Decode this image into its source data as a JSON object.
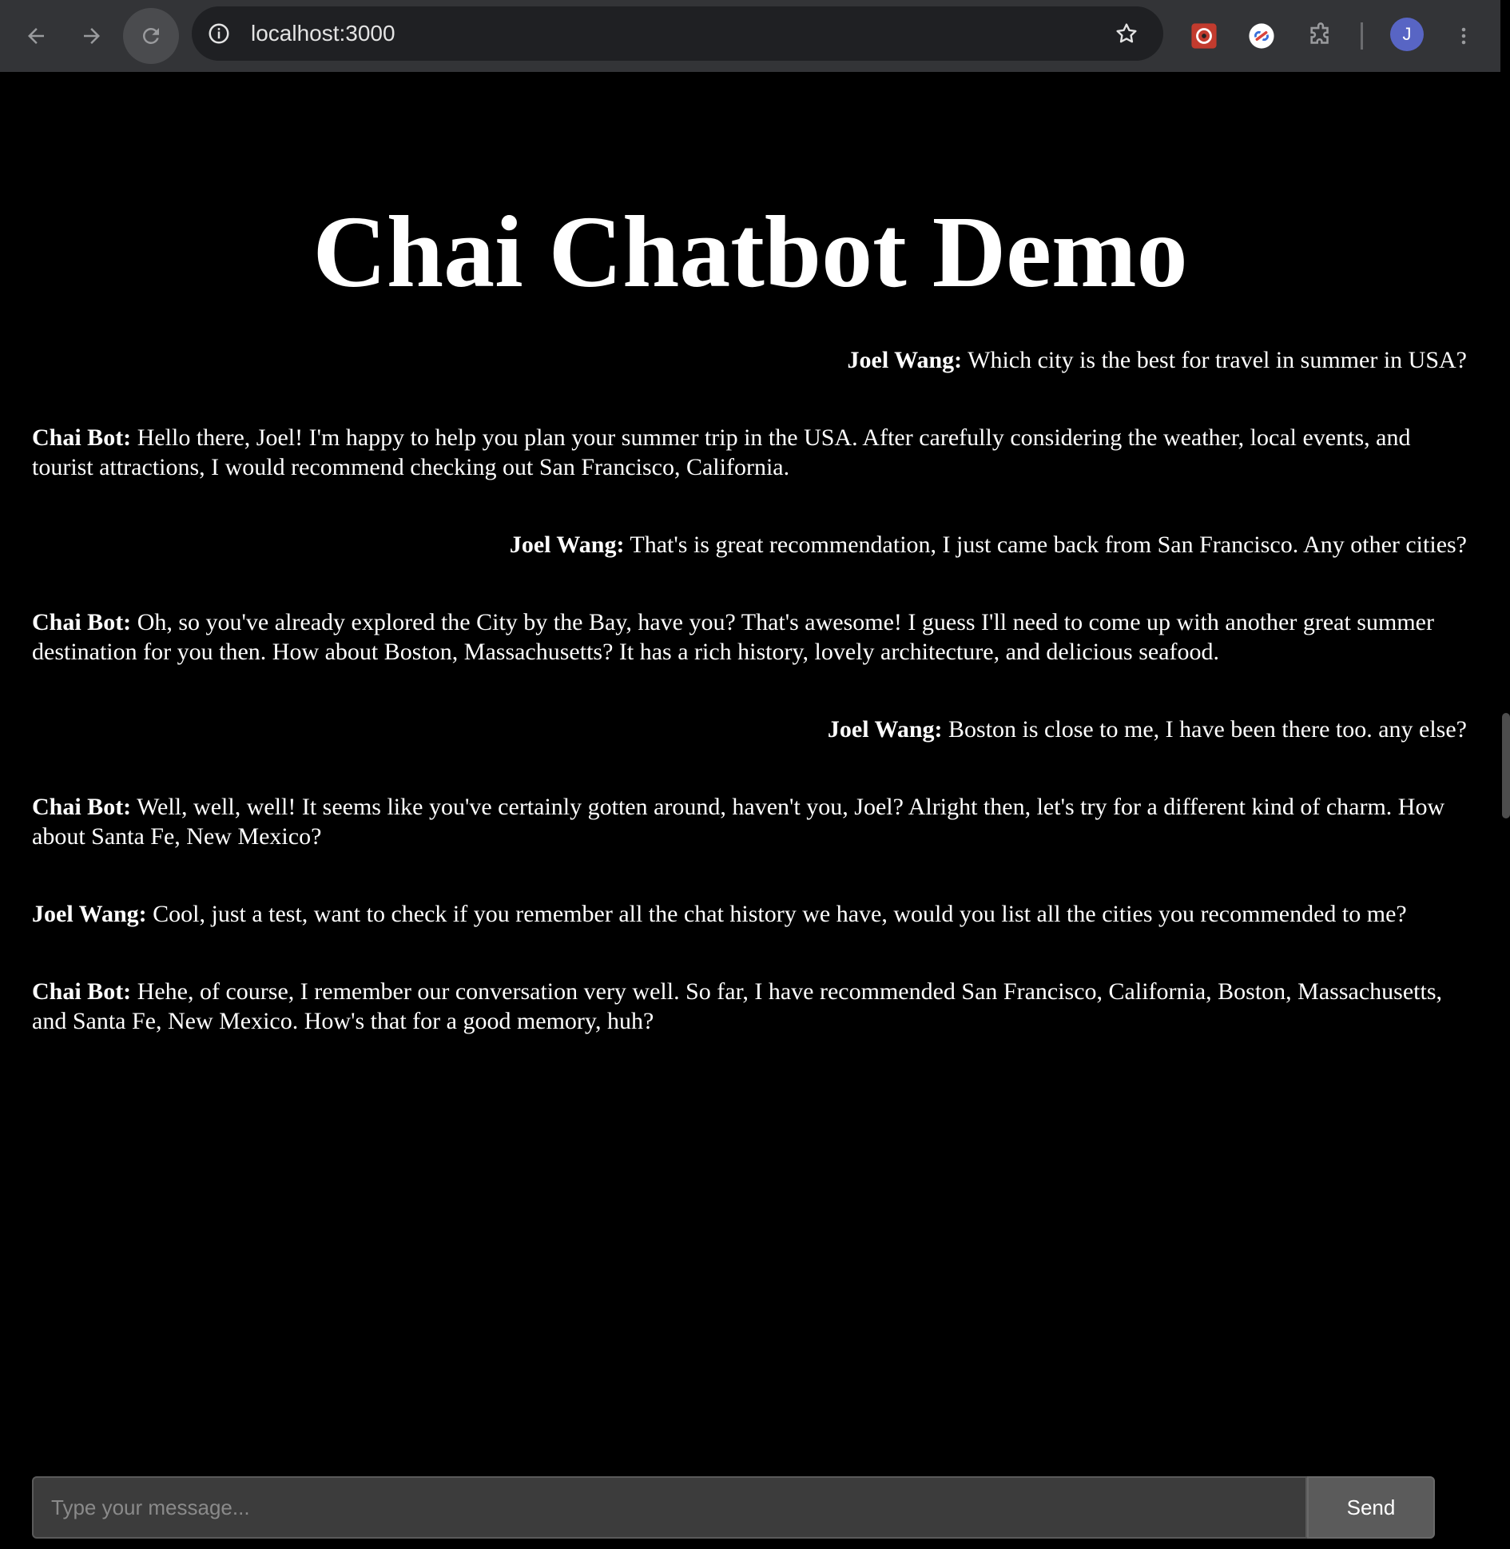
{
  "browser": {
    "url": "localhost:3000",
    "avatar_initial": "J",
    "icons": [
      "back-arrow-icon",
      "forward-arrow-icon",
      "reload-icon",
      "site-info-icon",
      "bookmark-star-icon",
      "extension-puzzle-icon",
      "kebab-menu-icon"
    ]
  },
  "page": {
    "title": "Chai Chatbot Demo"
  },
  "messages": [
    {
      "sender": "Joel Wang:",
      "text": " Which city is the best for travel in summer in USA?",
      "role": "user",
      "align": "right"
    },
    {
      "sender": "Chai Bot:",
      "text": " Hello there, Joel! I'm happy to help you plan your summer trip in the USA. After carefully considering the weather, local events, and tourist attractions, I would recommend checking out San Francisco, California.",
      "role": "bot",
      "align": "left"
    },
    {
      "sender": "Joel Wang:",
      "text": " That's is great recommendation, I just came back from San Francisco. Any other cities?",
      "role": "user",
      "align": "right"
    },
    {
      "sender": "Chai Bot:",
      "text": " Oh, so you've already explored the City by the Bay, have you? That's awesome! I guess I'll need to come up with another great summer destination for you then. How about Boston, Massachusetts? It has a rich history, lovely architecture, and delicious seafood.",
      "role": "bot",
      "align": "left"
    },
    {
      "sender": "Joel Wang:",
      "text": " Boston is close to me, I have been there too. any else?",
      "role": "user",
      "align": "right"
    },
    {
      "sender": "Chai Bot:",
      "text": " Well, well, well! It seems like you've certainly gotten around, haven't you, Joel? Alright then, let's try for a different kind of charm. How about Santa Fe, New Mexico?",
      "role": "bot",
      "align": "left"
    },
    {
      "sender": "Joel Wang:",
      "text": " Cool, just a test, want to check if you remember all the chat history we have, would you list all the cities you recommended to me?",
      "role": "user",
      "align": "left"
    },
    {
      "sender": "Chai Bot:",
      "text": " Hehe, of course, I remember our conversation very well. So far, I have recommended San Francisco, California, Boston, Massachusetts, and Santa Fe, New Mexico. How's that for a good memory, huh?",
      "role": "bot",
      "align": "left"
    }
  ],
  "composer": {
    "placeholder": "Type your message...",
    "value": "",
    "send_label": "Send"
  }
}
